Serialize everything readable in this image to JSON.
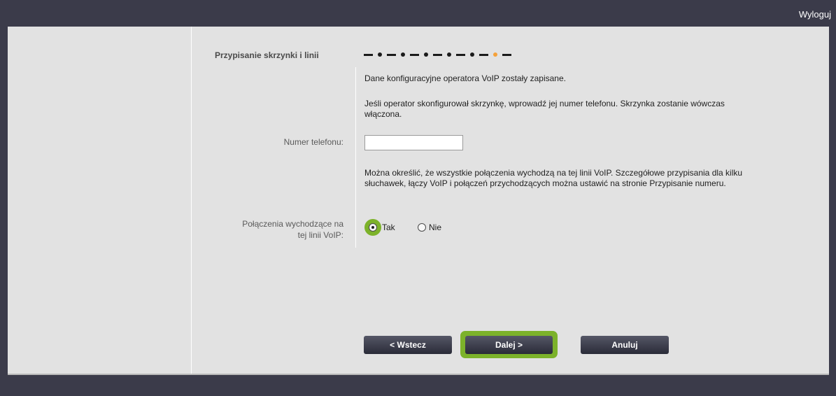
{
  "header": {
    "logout_label": "Wyloguj"
  },
  "wizard": {
    "section_title": "Przypisanie skrzynki i linii",
    "progress": {
      "total_steps": 6,
      "current_step": 6
    },
    "saved_message": "Dane konfiguracyjne operatora VoIP zostały zapisane.",
    "mailbox_info": "Jeśli operator skonfigurował skrzynkę, wprowadź jej numer telefonu. Skrzynka zostanie wówczas włączona.",
    "phone_label": "Numer telefonu:",
    "phone_value": "",
    "outgoing_info": "Można określić, że wszystkie połączenia wychodzą na tej linii VoIP. Szczegółowe przypisania dla kilku słuchawek, łączy VoIP i połączeń przychodzących można ustawić na stronie Przypisanie numeru.",
    "outgoing_label_line1": "Połączenia wychodzące na",
    "outgoing_label_line2": "tej linii VoIP:",
    "options": {
      "yes": "Tak",
      "no": "Nie",
      "selected": "yes"
    }
  },
  "buttons": {
    "back": "< Wstecz",
    "next": "Dalej >",
    "cancel": "Anuluj"
  },
  "colors": {
    "background": "#3b3b4a",
    "panel": "#e2e2e2",
    "highlight": "#7cb22a",
    "active_step": "#f5a13a"
  }
}
